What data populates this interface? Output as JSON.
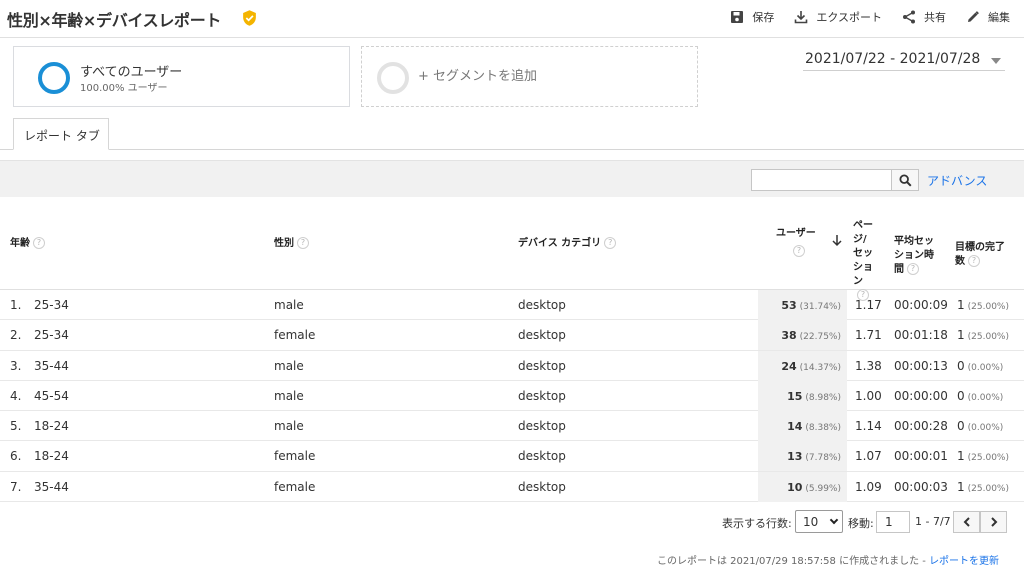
{
  "header": {
    "title": "性別×年齢×デバイスレポート",
    "toolbar": {
      "save": "保存",
      "export": "エクスポート",
      "share": "共有",
      "edit": "編集"
    }
  },
  "segments": {
    "active_name": "すべてのユーザー",
    "active_sub": "100.00% ユーザー",
    "add_label": "+ セグメントを追加"
  },
  "date_range": "2021/07/22 - 2021/07/28",
  "tabs": [
    "レポート タブ"
  ],
  "search": {
    "placeholder": "",
    "advanced": "アドバンス"
  },
  "table": {
    "headers": {
      "age": "年齢",
      "gender": "性別",
      "device": "デバイス カテゴリ",
      "users": "ユーザー",
      "pages_per_session": "ペー\nジ/\nセッ\nショ\nン",
      "avg_session": "平均セッ\nション時\n間",
      "goals": "目標の完了\n数"
    },
    "rows": [
      {
        "idx": "1.",
        "age": "25-34",
        "gender": "male",
        "device": "desktop",
        "users": "53",
        "users_pct": "(31.74%)",
        "pps": "1.17",
        "dur": "00:00:09",
        "goal": "1",
        "goal_pct": "(25.00%)"
      },
      {
        "idx": "2.",
        "age": "25-34",
        "gender": "female",
        "device": "desktop",
        "users": "38",
        "users_pct": "(22.75%)",
        "pps": "1.71",
        "dur": "00:01:18",
        "goal": "1",
        "goal_pct": "(25.00%)"
      },
      {
        "idx": "3.",
        "age": "35-44",
        "gender": "male",
        "device": "desktop",
        "users": "24",
        "users_pct": "(14.37%)",
        "pps": "1.38",
        "dur": "00:00:13",
        "goal": "0",
        "goal_pct": "(0.00%)"
      },
      {
        "idx": "4.",
        "age": "45-54",
        "gender": "male",
        "device": "desktop",
        "users": "15",
        "users_pct": "(8.98%)",
        "pps": "1.00",
        "dur": "00:00:00",
        "goal": "0",
        "goal_pct": "(0.00%)"
      },
      {
        "idx": "5.",
        "age": "18-24",
        "gender": "male",
        "device": "desktop",
        "users": "14",
        "users_pct": "(8.38%)",
        "pps": "1.14",
        "dur": "00:00:28",
        "goal": "0",
        "goal_pct": "(0.00%)"
      },
      {
        "idx": "6.",
        "age": "18-24",
        "gender": "female",
        "device": "desktop",
        "users": "13",
        "users_pct": "(7.78%)",
        "pps": "1.07",
        "dur": "00:00:01",
        "goal": "1",
        "goal_pct": "(25.00%)"
      },
      {
        "idx": "7.",
        "age": "35-44",
        "gender": "female",
        "device": "desktop",
        "users": "10",
        "users_pct": "(5.99%)",
        "pps": "1.09",
        "dur": "00:00:03",
        "goal": "1",
        "goal_pct": "(25.00%)"
      }
    ]
  },
  "pager": {
    "rows_label": "表示する行数:",
    "rows_value": "10",
    "goto_label": "移動:",
    "goto_value": "1",
    "range": "1 - 7/7"
  },
  "footer": {
    "created_text": "このレポートは 2021/07/29 18:57:58 に作成されました - ",
    "refresh_link": "レポートを更新"
  },
  "colors": {
    "accent": "#1a8fd6",
    "link": "#1a73e8",
    "verified": "#f4b400"
  }
}
